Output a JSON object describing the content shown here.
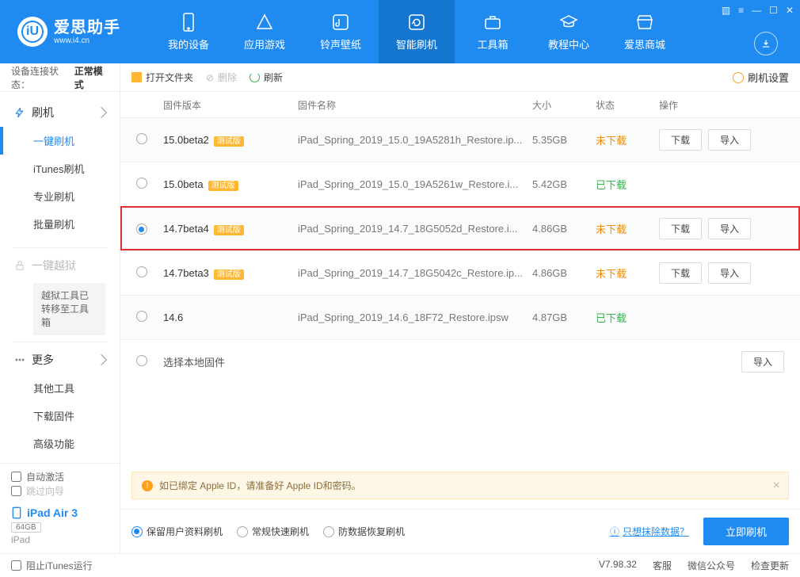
{
  "brand": {
    "name": "爱思助手",
    "url": "www.i4.cn"
  },
  "topnav": {
    "my_device": "我的设备",
    "apps": "应用游戏",
    "ringtones": "铃声壁纸",
    "flash": "智能刷机",
    "toolbox": "工具箱",
    "tutorials": "教程中心",
    "store": "爱思商城"
  },
  "sidebar": {
    "status_label": "设备连接状态：",
    "status_value": "正常模式",
    "flash_section": "刷机",
    "items": {
      "one_click": "一键刷机",
      "itunes": "iTunes刷机",
      "pro": "专业刷机",
      "batch": "批量刷机"
    },
    "jailbreak_section": "一键越狱",
    "jailbreak_note": "越狱工具已转移至工具箱",
    "more_section": "更多",
    "more": {
      "other_tools": "其他工具",
      "download_fw": "下载固件",
      "advanced": "高级功能"
    },
    "auto_activate": "自动激活",
    "skip_guide": "跳过向导",
    "device_name": "iPad Air 3",
    "device_cap": "64GB",
    "device_model": "iPad"
  },
  "toolbar": {
    "open": "打开文件夹",
    "delete": "删除",
    "refresh": "刷新",
    "settings": "刷机设置"
  },
  "columns": {
    "version": "固件版本",
    "name": "固件名称",
    "size": "大小",
    "status": "状态",
    "ops": "操作"
  },
  "status_labels": {
    "not_downloaded": "未下载",
    "downloaded": "已下载"
  },
  "buttons": {
    "download": "下载",
    "import": "导入"
  },
  "firmwares": [
    {
      "version": "15.0beta2",
      "beta": "测试版",
      "name": "iPad_Spring_2019_15.0_19A5281h_Restore.ip...",
      "size": "5.35GB",
      "status": "not_downloaded",
      "selected": false,
      "alt": true,
      "ops": [
        "download",
        "import"
      ]
    },
    {
      "version": "15.0beta",
      "beta": "测试版",
      "name": "iPad_Spring_2019_15.0_19A5261w_Restore.i...",
      "size": "5.42GB",
      "status": "downloaded",
      "selected": false,
      "alt": false,
      "ops": []
    },
    {
      "version": "14.7beta4",
      "beta": "测试版",
      "name": "iPad_Spring_2019_14.7_18G5052d_Restore.i...",
      "size": "4.86GB",
      "status": "not_downloaded",
      "selected": true,
      "alt": true,
      "ops": [
        "download",
        "import"
      ]
    },
    {
      "version": "14.7beta3",
      "beta": "测试版",
      "name": "iPad_Spring_2019_14.7_18G5042c_Restore.ip...",
      "size": "4.86GB",
      "status": "not_downloaded",
      "selected": false,
      "alt": false,
      "ops": [
        "download",
        "import"
      ]
    },
    {
      "version": "14.6",
      "beta": "",
      "name": "iPad_Spring_2019_14.6_18F72_Restore.ipsw",
      "size": "4.87GB",
      "status": "downloaded",
      "selected": false,
      "alt": true,
      "ops": []
    }
  ],
  "local_fw_label": "选择本地固件",
  "alert": "如已绑定 Apple ID，请准备好 Apple ID和密码。",
  "modes": {
    "keep_data": "保留用户资料刷机",
    "fast": "常规快速刷机",
    "anti_recovery": "防数据恢复刷机"
  },
  "erase_link": "只想抹除数据？",
  "flash_now": "立即刷机",
  "footer": {
    "block_itunes": "阻止iTunes运行",
    "version": "V7.98.32",
    "service": "客服",
    "wechat": "微信公众号",
    "update": "检查更新"
  }
}
